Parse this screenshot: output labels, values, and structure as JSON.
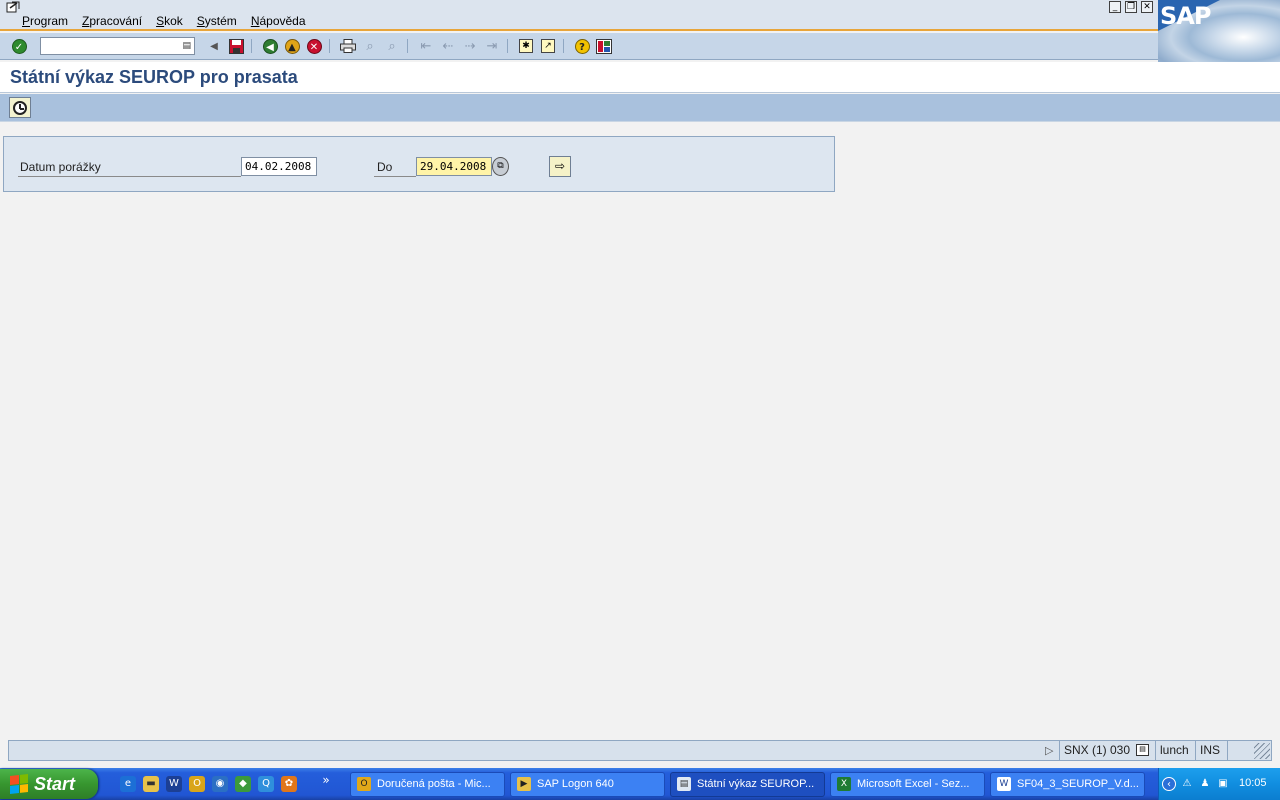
{
  "menu": {
    "items": [
      {
        "first": "P",
        "rest": "rogram"
      },
      {
        "first": "Z",
        "rest": "pracování"
      },
      {
        "first": "S",
        "rest": "kok"
      },
      {
        "first": "S",
        "rest": "ystém"
      },
      {
        "first": "N",
        "rest": "ápověda"
      }
    ]
  },
  "branding": {
    "logo": "SAP"
  },
  "command_field": {
    "value": ""
  },
  "page": {
    "title": "Státní výkaz SEUROP pro prasata"
  },
  "selection": {
    "label": "Datum porážky",
    "from_value": "04.02.2008",
    "to_label": "Do",
    "to_value": "29.04.2008"
  },
  "status": {
    "system": "SNX (1) 030",
    "host": "lunch",
    "mode": "INS"
  },
  "taskbar": {
    "start_label": "Start",
    "more": "»",
    "tasks": [
      {
        "label": "Doručená pošta - Mic..."
      },
      {
        "label": "SAP Logon 640"
      },
      {
        "label": "Státní výkaz SEUROP..."
      },
      {
        "label": "Microsoft Excel - Sez..."
      },
      {
        "label": "SF04_3_SEUROP_V.d..."
      }
    ],
    "clock": "10:05"
  },
  "colors": {
    "title": "#2c4b7c",
    "toolbar": "#c6d6e8",
    "app_toolbar": "#a9c1dd",
    "required_field": "#fff4a8",
    "taskbar": "#245edb"
  },
  "icons": {
    "toolbar": [
      "enter-icon",
      "command-dropdown-icon",
      "prev-icon",
      "save-icon",
      "back-icon",
      "exit-icon",
      "cancel-icon",
      "print-icon",
      "find-icon",
      "find-next-icon",
      "first-page-icon",
      "prev-page-icon",
      "next-page-icon",
      "last-page-icon",
      "new-session-icon",
      "shortcut-icon",
      "help-icon",
      "layout-icon"
    ],
    "app_toolbar": [
      "execute-clock-icon"
    ]
  }
}
